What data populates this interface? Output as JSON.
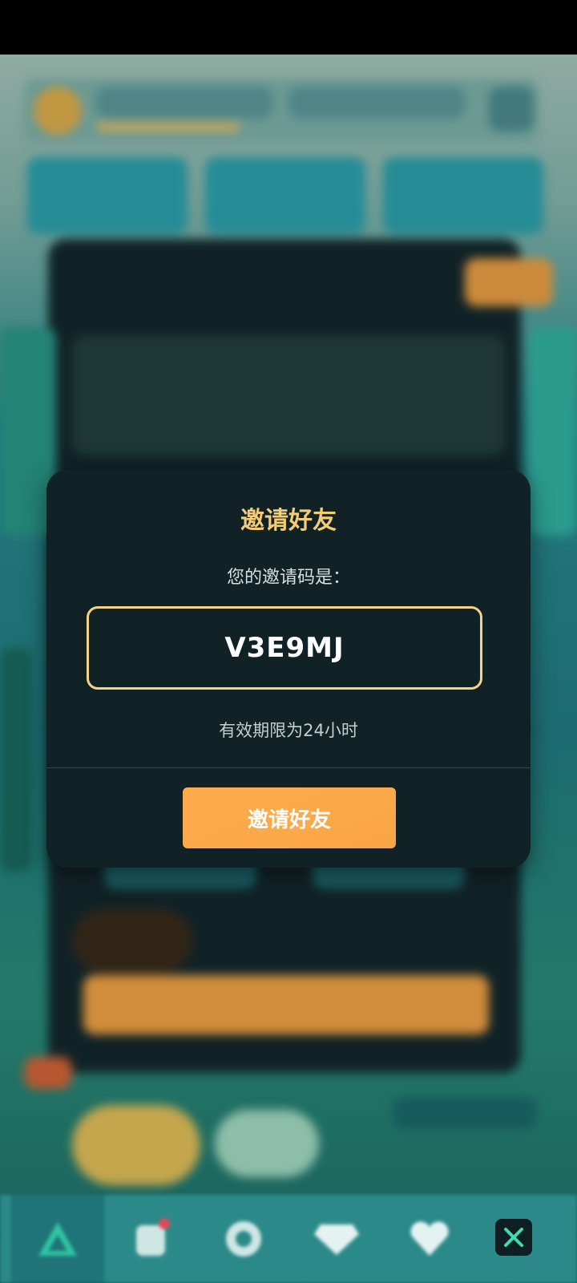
{
  "dialog": {
    "title": "邀请好友",
    "subtitle": "您的邀请码是：",
    "code": "V3E9MJ",
    "validity": "有效期限为24小时",
    "invite_button_label": "邀请好友"
  },
  "colors": {
    "accent_gold": "#f5cc73",
    "button_orange": "#fca949",
    "dialog_bg": "#102226",
    "close_icon": "#3fd9b3"
  },
  "bottom_nav": {
    "items": [
      {
        "icon": "pyramid-icon"
      },
      {
        "icon": "hero-icon"
      },
      {
        "icon": "gear-icon"
      },
      {
        "icon": "gem-icon"
      },
      {
        "icon": "heart-icon"
      }
    ],
    "close_icon": "close-icon"
  }
}
